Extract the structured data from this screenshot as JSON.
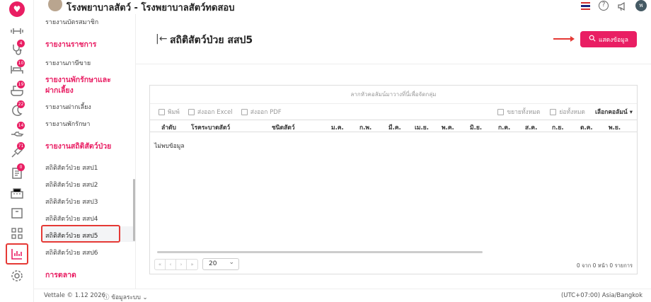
{
  "header": {
    "title": "โรงพยาบาลสัตว์ - โรงพยาบาลสัตว์ทดสอบ",
    "user_initial": "พ"
  },
  "rail": {
    "badges": [
      "4",
      "10",
      "19",
      "22",
      "14",
      "71",
      "0"
    ],
    "icons": [
      "heart-logo-icon",
      "dumbbell-icon",
      "stethoscope-icon",
      "bed-icon",
      "bath-icon",
      "moon-icon",
      "hand-icon",
      "syringe-icon",
      "register-icon",
      "cash-register-icon",
      "box-icon",
      "apps-icon",
      "chart-icon",
      "settings-icon"
    ]
  },
  "sidebar": {
    "top_partial": "รายงานบัตรสมาชิก",
    "h1": "รายงานราชการ",
    "i1": "รายงานภาษีขาย",
    "h2": "รายงานพักรักษาและฝากเลี้ยง",
    "i2": "รายงานฝากเลี้ยง",
    "i3": "รายงานพักรักษา",
    "h3": "รายงานสถิติสัตว์ป่วย",
    "stats": [
      "สถิติสัตว์ป่วย สสป1",
      "สถิติสัตว์ป่วย สสป2",
      "สถิติสัตว์ป่วย สสป3",
      "สถิติสัตว์ป่วย สสป4",
      "สถิติสัตว์ป่วย สสป5",
      "สถิติสัตว์ป่วย สสป6"
    ],
    "h4": "การตลาด"
  },
  "main": {
    "title": "สถิติสัตว์ป่วย สสป5",
    "show_button": "แสดงข้อมูล",
    "group_hint": "ลากหัวคอลัมน์มาวางที่นี่เพื่อจัดกลุ่ม",
    "toolbar": {
      "print": "พิมพ์",
      "excel": "ส่งออก Excel",
      "pdf": "ส่งออก PDF",
      "expand": "ขยายทั้งหมด",
      "collapse": "ย่อทั้งหมด",
      "choose_columns": "เลือกคอลัมน์"
    },
    "columns": [
      "ลำดับ",
      "โรคระบาดสัตว์",
      "ชนิดสัตว์",
      "ม.ค.",
      "ก.พ.",
      "มี.ค.",
      "เม.ย.",
      "พ.ค.",
      "มิ.ย.",
      "ก.ค.",
      "ส.ค.",
      "ก.ย.",
      "ต.ค.",
      "พ.ย."
    ],
    "no_data": "ไม่พบข้อมูล",
    "page_size": "20",
    "page_info": "0 จาก 0 หน้า 0 รายการ",
    "pager": [
      "«",
      "‹",
      "›",
      "»"
    ]
  },
  "footer": {
    "left": "Vettale © 1.12 2026",
    "status": "ⓘ ข้อมูลระบบ ⌄",
    "right": "(UTC+07:00) Asia/Bangkok"
  }
}
